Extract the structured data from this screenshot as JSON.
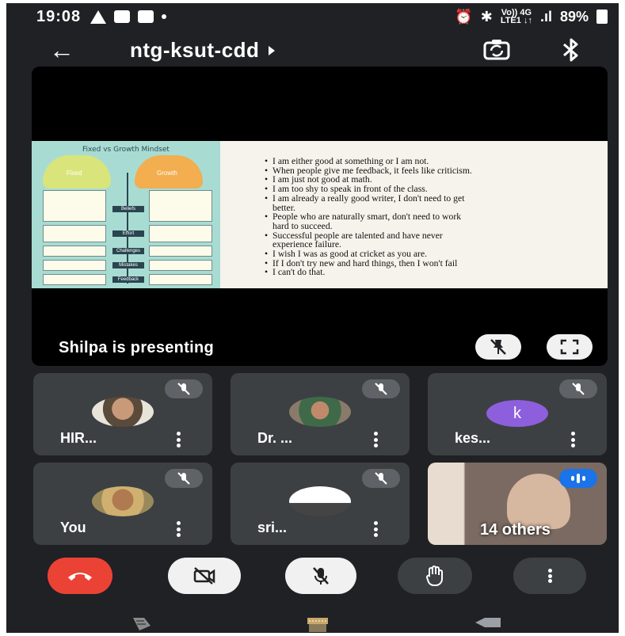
{
  "status_bar": {
    "time": "19:08",
    "network_top": "Vo)) 4G",
    "network_bottom": "LTE1 ↓↑",
    "battery": "89%"
  },
  "header": {
    "meeting_code": "ntg-ksut-cdd",
    "back_icon": "arrow-left-icon",
    "switch_camera_icon": "switch-camera-icon",
    "bluetooth_icon": "bluetooth-icon"
  },
  "presentation": {
    "slide": {
      "title": "Fixed vs Growth Mindset",
      "left_heads": [
        "Fixed",
        "Growth"
      ],
      "mid_labels": [
        "Beliefs",
        "Effort",
        "Challenges",
        "Mistakes",
        "Feedback"
      ],
      "bullets": [
        {
          "text": "I am either good at something or I am not.",
          "cont": ""
        },
        {
          "text": "When people give me feedback, it feels like criticism.",
          "cont": ""
        },
        {
          "text": "I am just not good at math.",
          "cont": ""
        },
        {
          "text": "I am too shy to speak in front of the class.",
          "cont": ""
        },
        {
          "text": "I am already a really good writer, I don't need to get",
          "cont": "better."
        },
        {
          "text": "People who are naturally smart, don't need to work",
          "cont": "hard to succeed."
        },
        {
          "text": "Successful people are talented and have never",
          "cont": "experience failure."
        },
        {
          "text": "I wish I was as good at cricket as you are.",
          "cont": ""
        },
        {
          "text": "If I don't try new and hard things, then I won't fail",
          "cont": ""
        },
        {
          "text": " I can't do that.",
          "cont": ""
        }
      ]
    },
    "presenting_label": "Shilpa is presenting"
  },
  "participants": [
    {
      "name": "HIR...",
      "type": "photo",
      "muted": true
    },
    {
      "name": "Dr. ...",
      "type": "photo",
      "muted": true
    },
    {
      "name": "kes...",
      "type": "letter",
      "letter": "k",
      "muted": true
    },
    {
      "name": "You",
      "type": "photo",
      "muted": true
    },
    {
      "name": "sri...",
      "type": "photo",
      "muted": true
    }
  ],
  "others_tile": {
    "label": "14 others"
  },
  "colors": {
    "background": "#202124",
    "tile": "#3c4043",
    "end_call": "#ea4335",
    "avatar_k": "#8e5fdc",
    "speaking": "#1a73e8"
  }
}
